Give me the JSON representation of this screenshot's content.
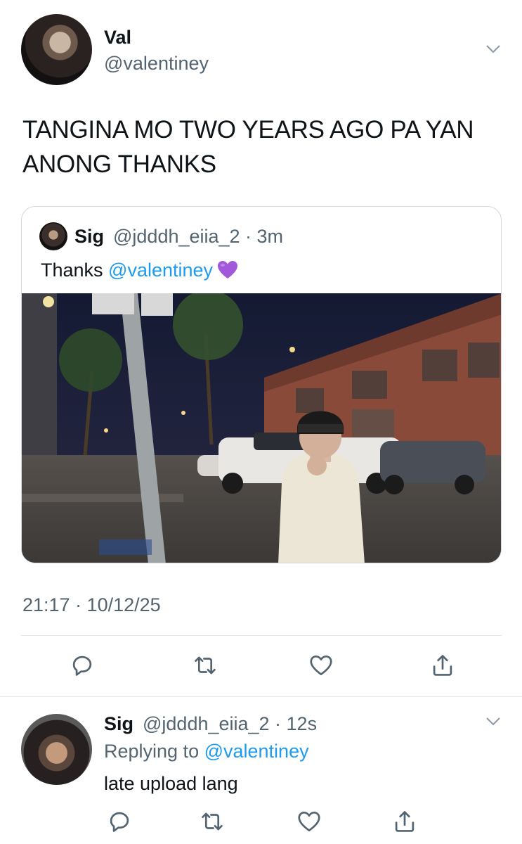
{
  "tweet": {
    "author_name": "Val",
    "author_handle": "@valentiney",
    "text": "TANGINA MO TWO YEARS AGO PA YAN ANONG THANKS",
    "timestamp": "21:17 · 10/12/25",
    "menu_icon": "chevron-down-icon"
  },
  "quote": {
    "author_name": "Sig",
    "meta": "@jdddh_eiia_2 · 3m",
    "text": "Thanks ",
    "mention": "@valentiney",
    "emoji_icon": "purple-heart-icon",
    "photo_icon": "night-street-photo"
  },
  "actions": {
    "reply_icon": "reply-icon",
    "retweet_icon": "retweet-icon",
    "like_icon": "like-icon",
    "share_icon": "share-icon"
  },
  "reply": {
    "author_name": "Sig",
    "meta": "@jdddh_eiia_2 · 12s",
    "replying_prefix": "Replying to ",
    "replying_mention": "@valentiney",
    "text": "late upload lang"
  },
  "colors": {
    "text_primary": "#0f1419",
    "text_secondary": "#536471",
    "accent": "#1d9bf0",
    "divider": "#e5e8eb",
    "emoji_purple": "#a259d9"
  }
}
